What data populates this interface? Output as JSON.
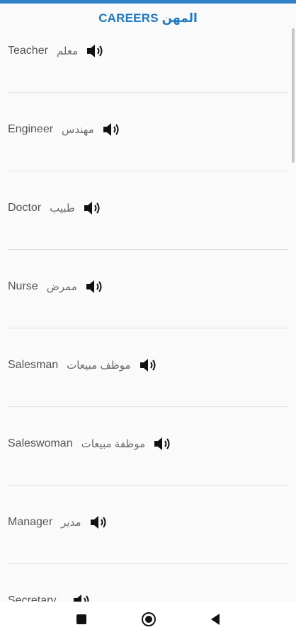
{
  "app": {
    "title": "CAREERS المهن",
    "accent_color": "#2f80c7",
    "title_color": "#1f78c1"
  },
  "careers": [
    {
      "en": "Teacher",
      "ar": "معلم",
      "icon": "speaker-icon"
    },
    {
      "en": "Engineer",
      "ar": "مهندس",
      "icon": "speaker-icon"
    },
    {
      "en": "Doctor",
      "ar": "طبيب",
      "icon": "speaker-icon"
    },
    {
      "en": "Nurse",
      "ar": "ممرض",
      "icon": "speaker-icon"
    },
    {
      "en": "Salesman",
      "ar": "موظف مبيعات",
      "icon": "speaker-icon"
    },
    {
      "en": "Saleswoman",
      "ar": "موظفة مبيعات",
      "icon": "speaker-icon"
    },
    {
      "en": "Manager",
      "ar": "مدير",
      "icon": "speaker-icon"
    },
    {
      "en": "Secretary",
      "ar": "",
      "icon": "speaker-icon"
    }
  ],
  "navbar": {
    "recent_icon": "square-icon",
    "home_icon": "circle-icon",
    "back_icon": "triangle-back-icon"
  }
}
